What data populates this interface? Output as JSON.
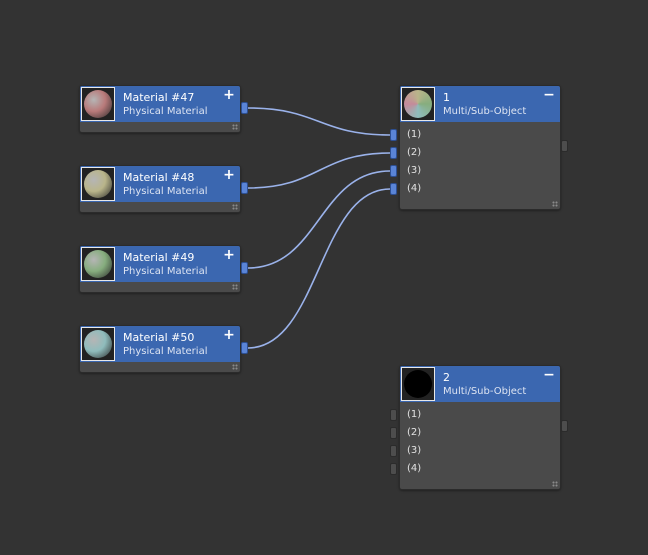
{
  "material_nodes": [
    {
      "title": "Material #47",
      "subtitle": "Physical Material",
      "toggle": "+",
      "swatch": "#b87a7a"
    },
    {
      "title": "Material #48",
      "subtitle": "Physical Material",
      "toggle": "+",
      "swatch": "#b9b58a"
    },
    {
      "title": "Material #49",
      "subtitle": "Physical Material",
      "toggle": "+",
      "swatch": "#86ad7e"
    },
    {
      "title": "Material #50",
      "subtitle": "Physical Material",
      "toggle": "+",
      "swatch": "#8fbcbc"
    }
  ],
  "multi_nodes": [
    {
      "title": "1",
      "subtitle": "Multi/Sub-Object",
      "toggle": "−",
      "slots": [
        "(1)",
        "(2)",
        "(3)",
        "(4)"
      ],
      "connected": [
        true,
        true,
        true,
        true
      ]
    },
    {
      "title": "2",
      "subtitle": "Multi/Sub-Object",
      "toggle": "−",
      "slots": [
        "(1)",
        "(2)",
        "(3)",
        "(4)"
      ],
      "connected": [
        false,
        false,
        false,
        false
      ]
    }
  ],
  "colors": {
    "background": "#333333",
    "node_body": "#4a4a4a",
    "node_header": "#3b67b0",
    "wire": "#9ab2ea",
    "port": "#5a84d6"
  }
}
